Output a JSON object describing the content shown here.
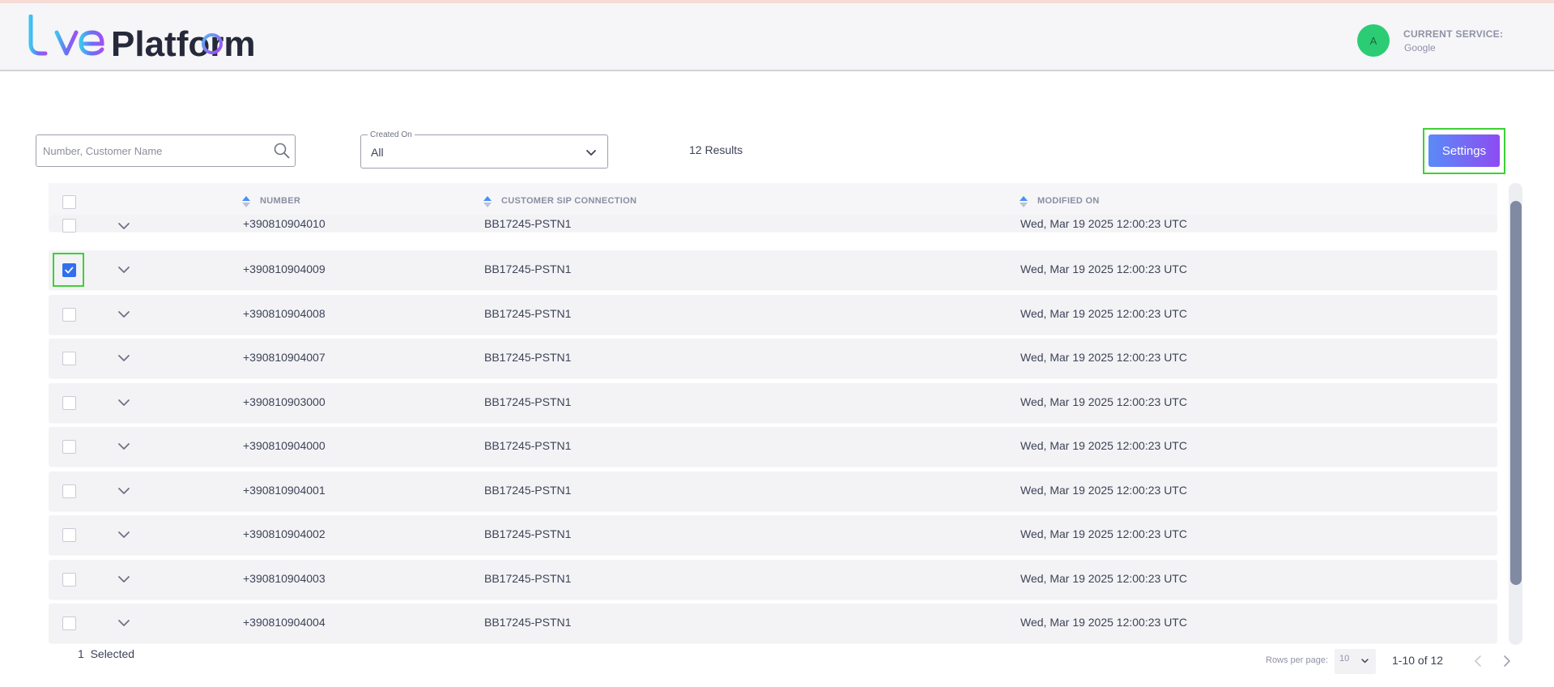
{
  "header": {
    "logo_text": "LivePlatform",
    "avatar_initial": "A",
    "service_label": "CURRENT SERVICE:",
    "service_value": "Google"
  },
  "toolbar": {
    "search_placeholder": "Number, Customer Name",
    "created_on_label": "Created On",
    "created_on_value": "All",
    "results_text": "12 Results",
    "settings_label": "Settings"
  },
  "table": {
    "columns": [
      "NUMBER",
      "CUSTOMER SIP CONNECTION",
      "MODIFIED ON"
    ],
    "rows": [
      {
        "number": "+390810904010",
        "connection": "BB17245-PSTN1",
        "modified": "Wed, Mar 19 2025 12:00:23 UTC",
        "checked": false
      },
      {
        "number": "+390810904009",
        "connection": "BB17245-PSTN1",
        "modified": "Wed, Mar 19 2025 12:00:23 UTC",
        "checked": true
      },
      {
        "number": "+390810904008",
        "connection": "BB17245-PSTN1",
        "modified": "Wed, Mar 19 2025 12:00:23 UTC",
        "checked": false
      },
      {
        "number": "+390810904007",
        "connection": "BB17245-PSTN1",
        "modified": "Wed, Mar 19 2025 12:00:23 UTC",
        "checked": false
      },
      {
        "number": "+390810903000",
        "connection": "BB17245-PSTN1",
        "modified": "Wed, Mar 19 2025 12:00:23 UTC",
        "checked": false
      },
      {
        "number": "+390810904000",
        "connection": "BB17245-PSTN1",
        "modified": "Wed, Mar 19 2025 12:00:23 UTC",
        "checked": false
      },
      {
        "number": "+390810904001",
        "connection": "BB17245-PSTN1",
        "modified": "Wed, Mar 19 2025 12:00:23 UTC",
        "checked": false
      },
      {
        "number": "+390810904002",
        "connection": "BB17245-PSTN1",
        "modified": "Wed, Mar 19 2025 12:00:23 UTC",
        "checked": false
      },
      {
        "number": "+390810904003",
        "connection": "BB17245-PSTN1",
        "modified": "Wed, Mar 19 2025 12:00:23 UTC",
        "checked": false
      },
      {
        "number": "+390810904004",
        "connection": "BB17245-PSTN1",
        "modified": "Wed, Mar 19 2025 12:00:23 UTC",
        "checked": false
      }
    ]
  },
  "footer": {
    "selected_text": "1  Selected",
    "rows_per_page_label": "Rows per page:",
    "rows_per_page_value": "10",
    "range_text": "1-10 of 12"
  },
  "icons": {
    "search": "search-icon",
    "dropdown": "chevron-down-icon",
    "expand": "chevron-down-icon",
    "sort": "sort-icon",
    "prev": "chevron-left-icon",
    "next": "chevron-right-icon",
    "check": "check-icon"
  },
  "colors": {
    "accent_gradient_start": "#5a8bf7",
    "accent_gradient_end": "#8d4cf3",
    "avatar": "#2bcc74",
    "checkbox_checked": "#2f6ff0",
    "highlight_frame": "#3fd035"
  }
}
